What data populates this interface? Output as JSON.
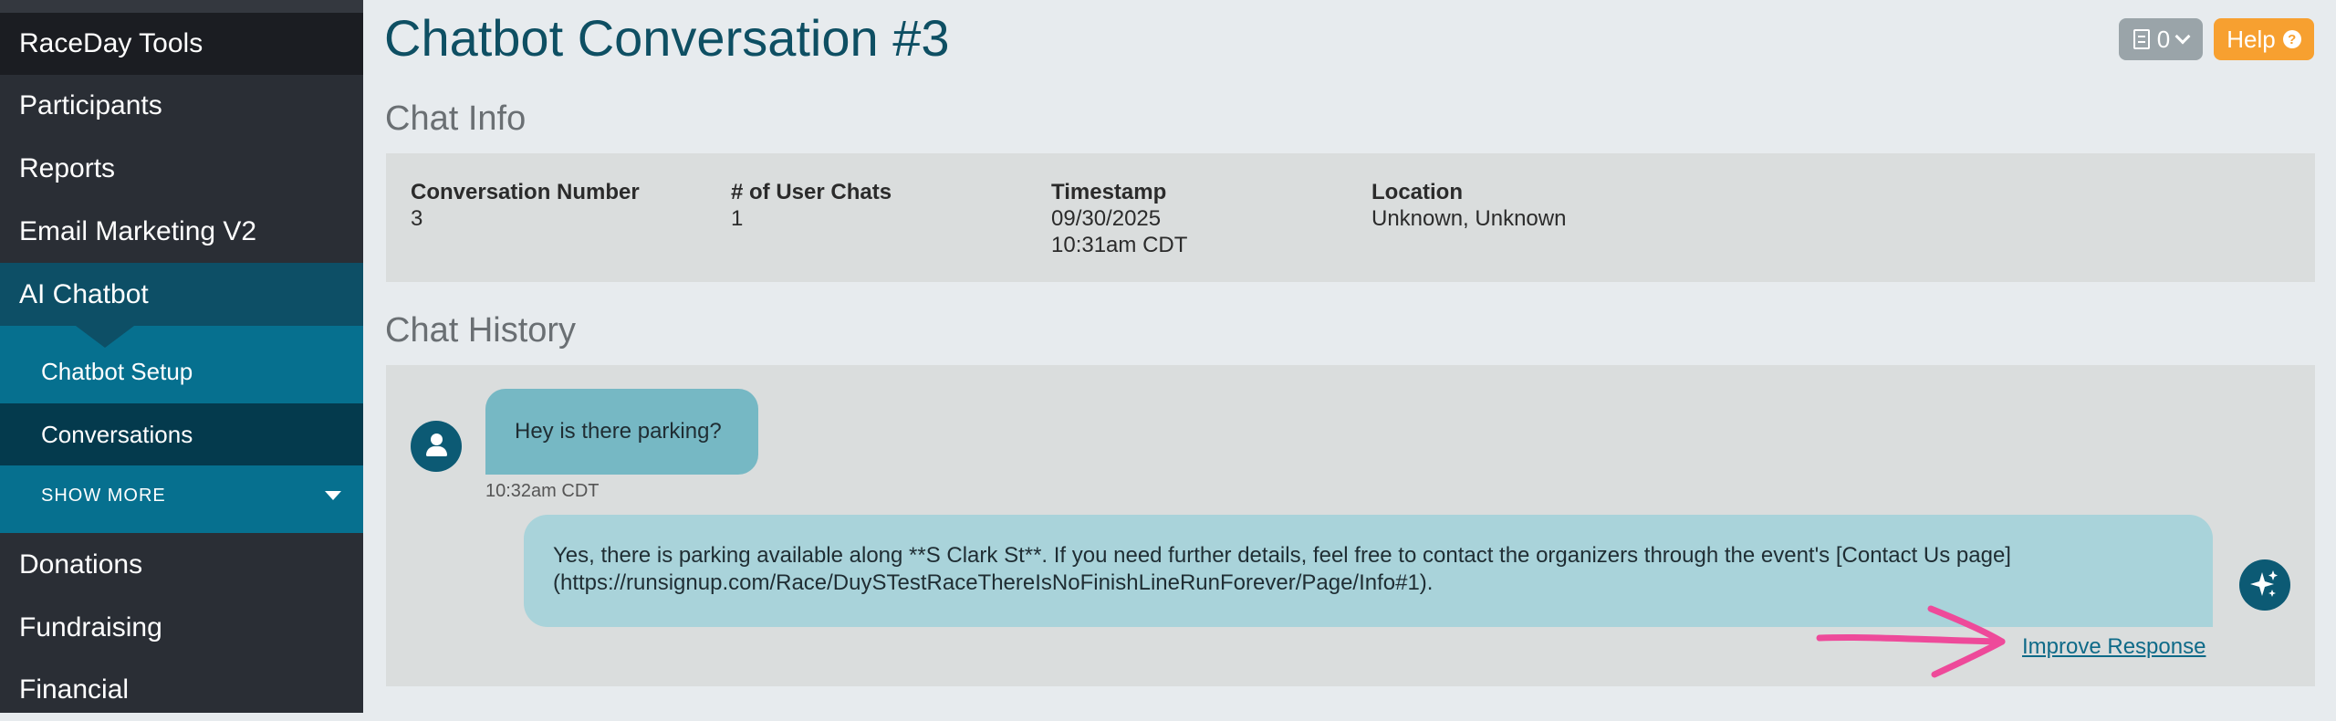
{
  "sidebar": {
    "items": [
      {
        "label": "RaceDay Tools"
      },
      {
        "label": "Participants"
      },
      {
        "label": "Reports"
      },
      {
        "label": "Email Marketing V2"
      },
      {
        "label": "AI Chatbot"
      },
      {
        "label": "Chatbot Setup"
      },
      {
        "label": "Conversations"
      },
      {
        "label": "SHOW  MORE"
      },
      {
        "label": "Donations"
      },
      {
        "label": "Fundraising"
      },
      {
        "label": "Financial"
      }
    ]
  },
  "header": {
    "title": "Chatbot Conversation #3",
    "notes_count": "0",
    "help_label": "Help"
  },
  "chat_info": {
    "heading": "Chat Info",
    "fields": [
      {
        "label": "Conversation Number",
        "value": "3"
      },
      {
        "label": "# of User Chats",
        "value": "1"
      },
      {
        "label": "Timestamp",
        "value": "09/30/2025",
        "value2": "10:31am CDT"
      },
      {
        "label": "Location",
        "value": "Unknown, Unknown"
      }
    ]
  },
  "chat_history": {
    "heading": "Chat History",
    "user_message": "Hey is there parking?",
    "user_time": "10:32am CDT",
    "bot_message_line1": "Yes, there is parking available along **S Clark St**. If you need further details, feel free to contact the organizers through the event's [Contact Us page]",
    "bot_message_line2": "(https://runsignup.com/Race/DuySTestRaceThereIsNoFinishLineRunForever/Page/Info#1).",
    "improve_label": "Improve Response"
  },
  "colors": {
    "sidebar_bg": "#2a2e35",
    "accent": "#0c5a74",
    "help_orange": "#f7a030",
    "annotation_pink": "#ee4a9a"
  }
}
